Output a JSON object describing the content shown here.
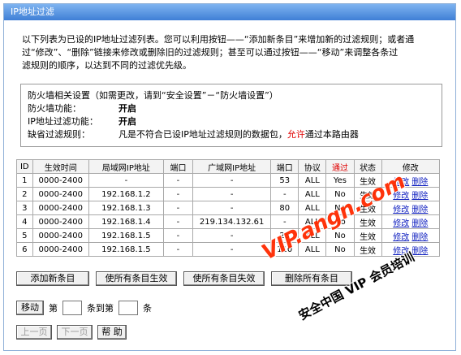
{
  "window": {
    "title": "IP地址过滤"
  },
  "intro": {
    "line1": "以下列表为已设的IP地址过滤列表。您可以利用按钮——“添加新条目”来增加新的过滤规则；或者通",
    "line2": "过“修改”、“删除”链接来修改或删除旧的过滤规则；甚至可以通过按钮——“移动”来调整各条过",
    "line3": "滤规则的顺序，以达到不同的过滤优先级。"
  },
  "firewall": {
    "heading": "防火墙相关设置（如需更改，请到“安全设置”－“防火墙设置”）",
    "firewall_label": "防火墙功能：",
    "firewall_value": "开启",
    "ipfilter_label": "IP地址过滤功能：",
    "ipfilter_value": "开启",
    "default_label": "缺省过滤规则：",
    "default_prefix": "凡是不符合已设IP地址过滤规则的数据包，",
    "default_allow": "允许",
    "default_suffix": "通过本路由器"
  },
  "table": {
    "headers": [
      "ID",
      "生效时间",
      "局域网IP地址",
      "端口",
      "广域网IP地址",
      "端口",
      "协议",
      "通过",
      "状态",
      "修改"
    ],
    "rows": [
      [
        "1",
        "0000-2400",
        "-",
        "-",
        "-",
        "53",
        "ALL",
        "Yes",
        "生效"
      ],
      [
        "2",
        "0000-2400",
        "192.168.1.2",
        "-",
        "-",
        "-",
        "ALL",
        "No",
        "生效"
      ],
      [
        "3",
        "0000-2400",
        "192.168.1.3",
        "-",
        "-",
        "80",
        "ALL",
        "No",
        "生效"
      ],
      [
        "4",
        "0000-2400",
        "192.168.1.4",
        "-",
        "219.134.132.61",
        "-",
        "ALL",
        "No",
        "生效"
      ],
      [
        "5",
        "0000-2400",
        "192.168.1.5",
        "-",
        "-",
        "25",
        "ALL",
        "No",
        "生效"
      ],
      [
        "6",
        "0000-2400",
        "192.168.1.5",
        "-",
        "-",
        "110",
        "ALL",
        "No",
        "生效"
      ]
    ],
    "edit_label": "修改",
    "delete_label": "删除"
  },
  "buttons": {
    "add": "添加新条目",
    "enable_all": "使所有条目生效",
    "disable_all": "使所有条目失效",
    "delete_all": "删除所有条目"
  },
  "move": {
    "button": "移动",
    "label_no": "第",
    "label_to": "条到第",
    "label_item": "条"
  },
  "nav": {
    "prev": "上一页",
    "next": "下一页",
    "help": "帮 助"
  },
  "watermark": {
    "line1": "VIP.angn.com",
    "line2": "安全中国 VIP 会员培训"
  }
}
